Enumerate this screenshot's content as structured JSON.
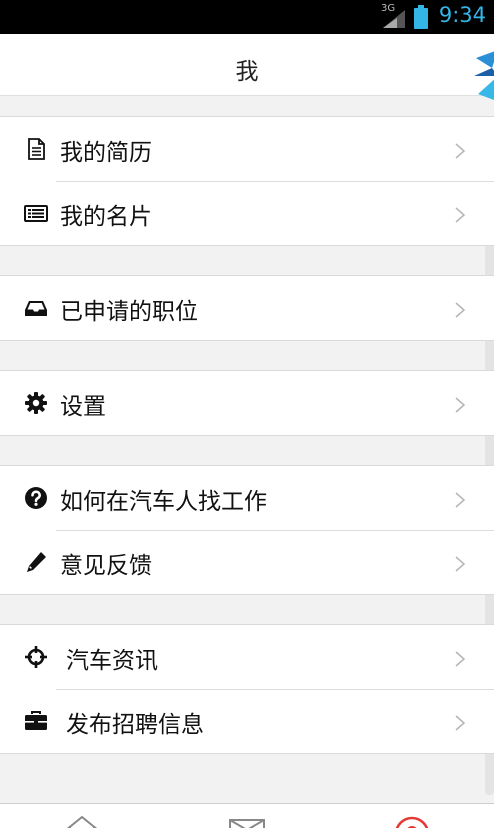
{
  "status_bar": {
    "network": "3G",
    "time": "9:34",
    "accent_color": "#33b5e5"
  },
  "header": {
    "title": "我"
  },
  "groups": [
    {
      "items": [
        {
          "label": "我的简历",
          "icon": "document-icon"
        },
        {
          "label": "我的名片",
          "icon": "card-list-icon"
        }
      ]
    },
    {
      "items": [
        {
          "label": "已申请的职位",
          "icon": "inbox-icon"
        }
      ]
    },
    {
      "items": [
        {
          "label": "设置",
          "icon": "gear-icon"
        }
      ]
    },
    {
      "items": [
        {
          "label": "如何在汽车人找工作",
          "icon": "question-circle-icon"
        },
        {
          "label": "意见反馈",
          "icon": "pencil-icon"
        }
      ]
    },
    {
      "items": [
        {
          "label": "汽车资讯",
          "icon": "crosshair-icon"
        },
        {
          "label": "发布招聘信息",
          "icon": "briefcase-icon"
        }
      ]
    }
  ],
  "tabbar": {
    "tabs": [
      {
        "icon": "home-icon"
      },
      {
        "icon": "mail-icon"
      },
      {
        "icon": "user-icon",
        "active": true,
        "color": "#e53935"
      }
    ]
  }
}
